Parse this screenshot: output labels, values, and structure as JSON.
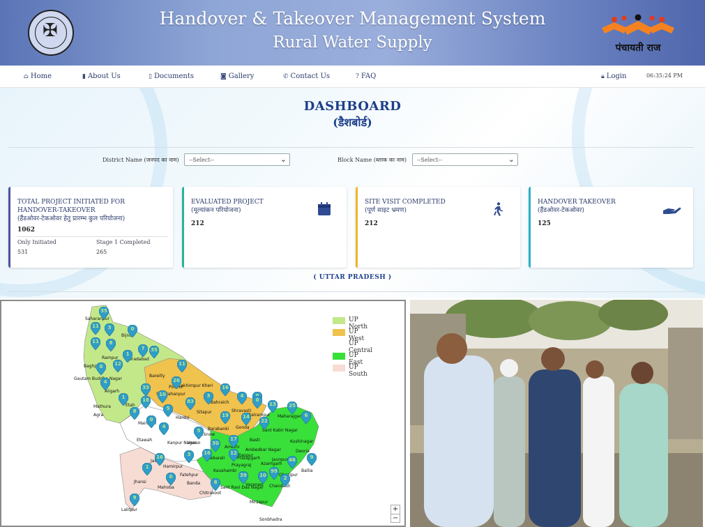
{
  "header": {
    "title_line1": "Handover & Takeover Management System",
    "title_line2": "Rural Water Supply",
    "logo_right_text": "पंचायती राज",
    "emblem_icon": "up-state-emblem-icon"
  },
  "nav": {
    "items": [
      {
        "label": "Home",
        "icon": "home-icon"
      },
      {
        "label": "About Us",
        "icon": "building-icon"
      },
      {
        "label": "Documents",
        "icon": "document-icon"
      },
      {
        "label": "Gallery",
        "icon": "camera-icon"
      },
      {
        "label": "Contact Us",
        "icon": "phone-icon"
      },
      {
        "label": "FAQ",
        "icon": "question-icon"
      }
    ],
    "login": "Login",
    "clock": "06:35:24 PM"
  },
  "dashboard": {
    "title": "DASHBOARD",
    "subtitle": "(डैशबोर्ड)"
  },
  "filters": {
    "district_label": "District Name (जनपद का नाम)",
    "district_value": "--Select--",
    "block_label": "Block Name (ब्लाक का नाम)",
    "block_value": "--Select--"
  },
  "cards": [
    {
      "title_en": "TOTAL PROJECT INITIATED FOR HANDOVER-TAKEOVER",
      "title_hi": "(हैंडओवर-टेकओवर हेतु प्रारम्भ कुल परियोजना)",
      "value": "1062",
      "only_initiated_label": "Only Initiated",
      "only_initiated_value": "531",
      "stage1_label": "Stage 1 Completed",
      "stage1_value": "265",
      "border_color": "#4a55a0"
    },
    {
      "title_en": "EVALUATED PROJECT",
      "title_hi": "(मूल्यांकन परियोजना)",
      "value": "212",
      "icon": "calendar-icon",
      "border_color": "#2bb39a"
    },
    {
      "title_en": "SITE VISIT COMPLETED",
      "title_hi": "(पूर्ण साइट भ्रमण)",
      "value": "212",
      "icon": "walking-person-icon",
      "border_color": "#f0b429"
    },
    {
      "title_en": "HANDOVER TAKEOVER",
      "title_hi": "(हैंडओवर-टेकओवर)",
      "value": "125",
      "icon": "hand-holding-icon",
      "border_color": "#2ab0c8"
    }
  ],
  "state_label": "( UTTAR PRADESH )",
  "legend": [
    {
      "label": "UP North",
      "color": "#c3e88a"
    },
    {
      "label": "UP West",
      "color": "#f0c24e"
    },
    {
      "label": "UP Central",
      "color": "#ffffff"
    },
    {
      "label": "UP East",
      "color": "#39e03a"
    },
    {
      "label": "UP South",
      "color": "#f7dcd4"
    }
  ],
  "map_labels": [
    "Saharanpur",
    "Bijnor",
    "Moradabad",
    "Rampur",
    "Bareilly",
    "Pilibhit",
    "Lakhimpur Kheri",
    "Shahjahanpur",
    "Gautam Buddha Nagar",
    "Aligarh",
    "Mathura",
    "Agra",
    "Etah",
    "Mainpuri",
    "Etawah",
    "Hardoi",
    "Sitapur",
    "Bahraich",
    "Shravasti",
    "Balrampur",
    "Gonda",
    "Barabanki",
    "Lucknow",
    "Unnao",
    "Kanpur Nagar",
    "Jalaun",
    "Jhansi",
    "Hamirpur",
    "Mahoba",
    "Banda",
    "Chitrakoot",
    "Lalitpur",
    "Kaushambi",
    "Prayagraj",
    "Sant Ravi Das Nagar",
    "Varanasi",
    "Chandauli",
    "Mirzapur",
    "Sonbhadra",
    "Ghazipur",
    "Ballia",
    "Deoria",
    "Kushinagar",
    "Maharajganj",
    "Sant Kabir Nagar",
    "Basti",
    "Azamgarh",
    "Ambedkar Nagar",
    "Sultanpur",
    "Amethi",
    "Raebareli",
    "Pratapgarh",
    "Jaunpur",
    "Fatehpur",
    "Baghpat"
  ],
  "markers": [
    {
      "n": "35",
      "c": "#c3e88a"
    },
    {
      "n": "11",
      "c": "#c3e88a"
    },
    {
      "n": "3",
      "c": "#c3e88a"
    },
    {
      "n": "11",
      "c": "#c3e88a"
    },
    {
      "n": "8",
      "c": "#c3e88a"
    },
    {
      "n": "0",
      "c": "#c3e88a"
    },
    {
      "n": "35",
      "c": "#c3e88a"
    },
    {
      "n": "7",
      "c": "#c3e88a"
    },
    {
      "n": "1",
      "c": "#c3e88a"
    },
    {
      "n": "0",
      "c": "#c3e88a"
    },
    {
      "n": "12",
      "c": "#c3e88a"
    },
    {
      "n": "11",
      "c": "#c3e88a"
    },
    {
      "n": "4",
      "c": "#c3e88a"
    },
    {
      "n": "26",
      "c": "#c3e88a"
    },
    {
      "n": "33",
      "c": "#c3e88a"
    },
    {
      "n": "10",
      "c": "#c3e88a"
    },
    {
      "n": "18",
      "c": "#c3e88a"
    },
    {
      "n": "1",
      "c": "#c3e88a"
    },
    {
      "n": "8",
      "c": "#c3e88a"
    },
    {
      "n": "5",
      "c": "#c3e88a"
    },
    {
      "n": "0",
      "c": "#c3e88a"
    },
    {
      "n": "4",
      "c": "#c3e88a"
    },
    {
      "n": "83",
      "c": "#c3e88a"
    },
    {
      "n": "3",
      "c": "#c3e88a"
    },
    {
      "n": "16",
      "c": "#c3e88a"
    },
    {
      "n": "4",
      "c": "#c3e88a"
    },
    {
      "n": "0",
      "c": "#c3e88a"
    },
    {
      "n": "13",
      "c": "#c3e88a"
    },
    {
      "n": "25",
      "c": "#c3e88a"
    },
    {
      "n": "6",
      "c": "#c3e88a"
    },
    {
      "n": "19",
      "c": "#c3e88a"
    },
    {
      "n": "14",
      "c": "#c3e88a"
    },
    {
      "n": "22",
      "c": "#c3e88a"
    },
    {
      "n": "0",
      "c": "#c3e88a"
    },
    {
      "n": "5",
      "c": "#c3e88a"
    },
    {
      "n": "17",
      "c": "#c3e88a"
    },
    {
      "n": "30",
      "c": "#c3e88a"
    },
    {
      "n": "16",
      "c": "#c3e88a"
    },
    {
      "n": "12",
      "c": "#c3e88a"
    },
    {
      "n": "46",
      "c": "#c3e88a"
    },
    {
      "n": "9",
      "c": "#c3e88a"
    },
    {
      "n": "99",
      "c": "#c3e88a"
    },
    {
      "n": "39",
      "c": "#c3e88a"
    },
    {
      "n": "8",
      "c": "#c3e88a"
    },
    {
      "n": "10",
      "c": "#c3e88a"
    },
    {
      "n": "2",
      "c": "#c3e88a"
    },
    {
      "n": "16",
      "c": "#c3e88a"
    },
    {
      "n": "0",
      "c": "#c3e88a"
    },
    {
      "n": "9",
      "c": "#c3e88a"
    },
    {
      "n": "1",
      "c": "#c3e88a"
    },
    {
      "n": "3",
      "c": "#c3e88a"
    }
  ],
  "zoom": {
    "in": "+",
    "out": "−"
  },
  "photo_icon": "site-visit-photo"
}
